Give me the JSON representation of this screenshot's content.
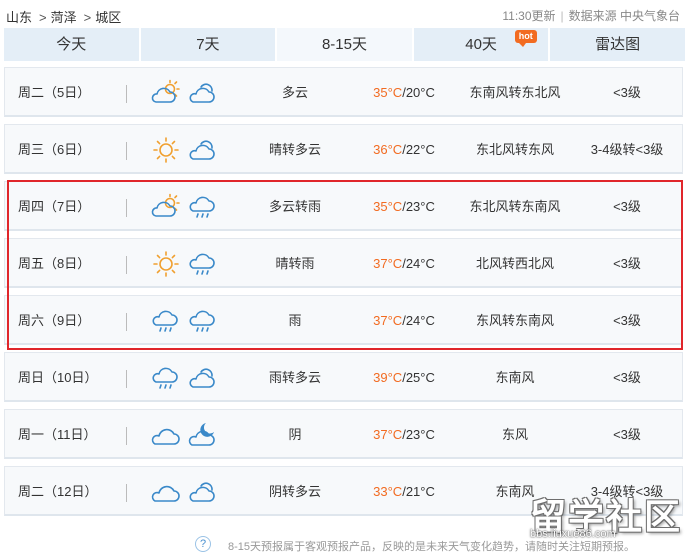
{
  "breadcrumb": [
    "山东",
    "菏泽",
    "城区"
  ],
  "meta": {
    "update_time": "11:30更新",
    "source": "数据来源 中央气象台"
  },
  "tabs": [
    {
      "label": "今天",
      "active": false
    },
    {
      "label": "7天",
      "active": false
    },
    {
      "label": "8-15天",
      "active": true
    },
    {
      "label": "40天",
      "active": false,
      "badge": "hot"
    },
    {
      "label": "雷达图",
      "active": false
    }
  ],
  "rows": [
    {
      "day": "周二（5日）",
      "icon1": "partly-cloudy-icon",
      "icon2": "cloudy-night-icon",
      "desc": "多云",
      "high": "35°C",
      "low": "20°C",
      "wind": "东南风转东北风",
      "level": "<3级"
    },
    {
      "day": "周三（6日）",
      "icon1": "sun-icon",
      "icon2": "cloudy-night-icon",
      "desc": "晴转多云",
      "high": "36°C",
      "low": "22°C",
      "wind": "东北风转东风",
      "level": "3-4级转<3级"
    },
    {
      "day": "周四（7日）",
      "icon1": "partly-cloudy-icon",
      "icon2": "rain-icon",
      "desc": "多云转雨",
      "high": "35°C",
      "low": "23°C",
      "wind": "东北风转东南风",
      "level": "<3级"
    },
    {
      "day": "周五（8日）",
      "icon1": "sun-icon",
      "icon2": "rain-icon",
      "desc": "晴转雨",
      "high": "37°C",
      "low": "24°C",
      "wind": "北风转西北风",
      "level": "<3级"
    },
    {
      "day": "周六（9日）",
      "icon1": "rain-icon",
      "icon2": "rain-icon",
      "desc": "雨",
      "high": "37°C",
      "low": "24°C",
      "wind": "东风转东南风",
      "level": "<3级"
    },
    {
      "day": "周日（10日）",
      "icon1": "rain-icon",
      "icon2": "cloudy-night-icon",
      "desc": "雨转多云",
      "high": "39°C",
      "low": "25°C",
      "wind": "东南风",
      "level": "<3级"
    },
    {
      "day": "周一（11日）",
      "icon1": "overcast-icon",
      "icon2": "moon-cloud-icon",
      "desc": "阴",
      "high": "37°C",
      "low": "23°C",
      "wind": "东风",
      "level": "<3级"
    },
    {
      "day": "周二（12日）",
      "icon1": "overcast-icon",
      "icon2": "cloudy-night-icon",
      "desc": "阴转多云",
      "high": "33°C",
      "low": "21°C",
      "wind": "东南风",
      "level": "3-4级转<3级"
    }
  ],
  "footer": {
    "note": "8-15天预报属于客观预报产品，反映的是未来天气变化趋势，请随时关注短期预报。"
  },
  "watermark": {
    "logo": "留学社区",
    "url": "bbs.liuxue86.com"
  },
  "colors": {
    "high_temp": "#f26b21",
    "tab_bg": "#e4eef7",
    "highlight_border": "#e0262b",
    "icon_blue": "#3a89c9",
    "sun_orange": "#f0a030"
  }
}
